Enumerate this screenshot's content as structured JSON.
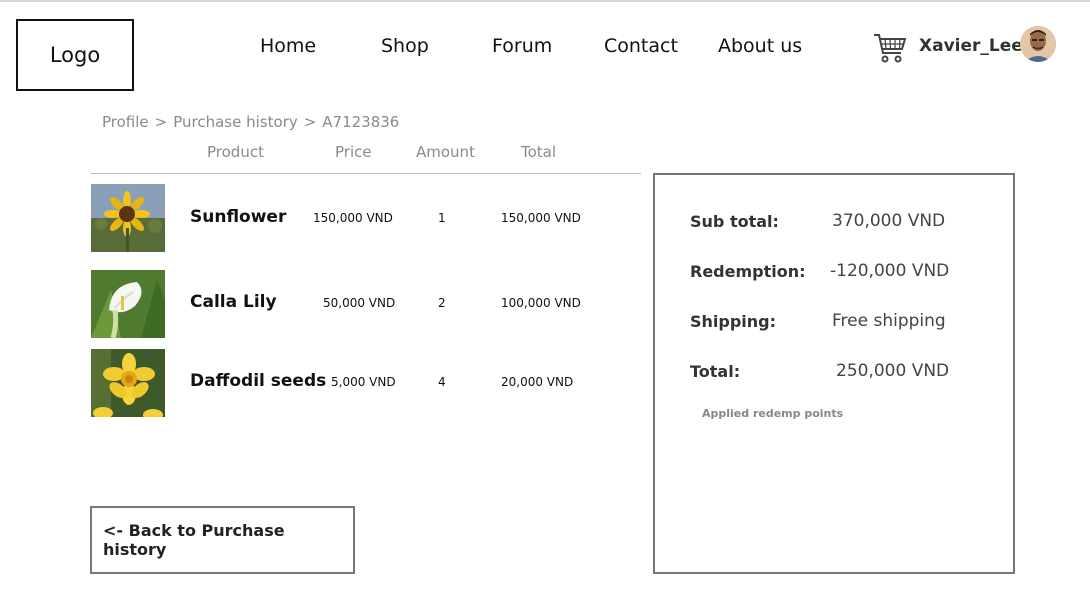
{
  "header": {
    "logo": "Logo",
    "nav": [
      "Home",
      "Shop",
      "Forum",
      "Contact",
      "About us"
    ],
    "username": "Xavier_Lee"
  },
  "breadcrumb": [
    "Profile",
    "Purchase history",
    "A7123836"
  ],
  "breadcrumb_sep": ">",
  "table": {
    "headers": [
      "Product",
      "Price",
      "Amount",
      "Total"
    ],
    "rows": [
      {
        "name": "Sunflower",
        "price": "150,000 VND",
        "amount": "1",
        "total": "150,000 VND",
        "image": "sunflower"
      },
      {
        "name": "Calla Lily",
        "price": "50,000 VND",
        "amount": "2",
        "total": "100,000 VND",
        "image": "calla-lily"
      },
      {
        "name": "Daffodil seeds",
        "price": "5,000 VND",
        "amount": "4",
        "total": "20,000 VND",
        "image": "daffodil"
      }
    ]
  },
  "summary": {
    "subtotal_label": "Sub total:",
    "subtotal_value": "370,000 VND",
    "redemption_label": "Redemption:",
    "redemption_value": "-120,000 VND",
    "shipping_label": "Shipping:",
    "shipping_value": "Free shipping",
    "total_label": "Total:",
    "total_value": "250,000 VND",
    "note": "Applied redemp points"
  },
  "back_button": "<- Back to Purchase history"
}
